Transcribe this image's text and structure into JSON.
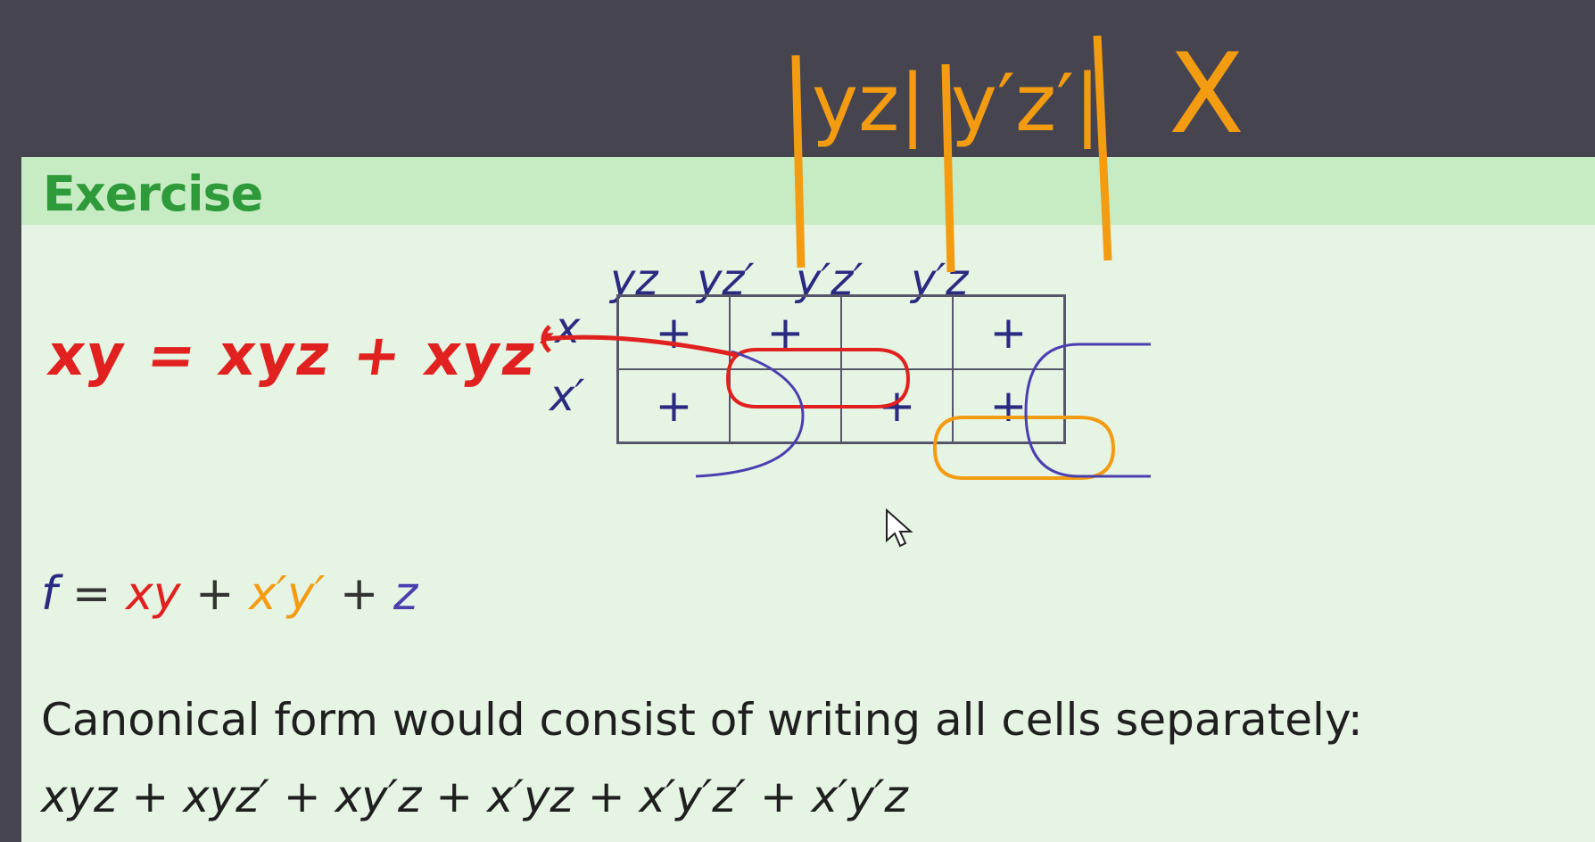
{
  "slide": {
    "title": "Exercise",
    "kmap": {
      "col_headers": [
        "yz",
        "yz′",
        "y′z′",
        "y′z"
      ],
      "row_headers": [
        "x",
        "x′"
      ],
      "cells": [
        [
          "+",
          "+",
          "",
          "+"
        ],
        [
          "+",
          "",
          "+",
          "+"
        ]
      ]
    },
    "function": {
      "lhs": "f",
      "eq": "=",
      "t1": "xy",
      "p1": "+",
      "t2": "x′y′",
      "p2": "+",
      "t3": "z"
    },
    "canonical_text": "Canonical form would consist of writing all cells separately:",
    "canonical_expr": "xyz + xyz′ + xy′z + x′yz + x′y′z′ + x′y′z"
  },
  "annotations": {
    "red_note": "xy = xyz + xyz′",
    "orange_cols": "yz| y′z′|",
    "orange_x": "X"
  },
  "colors": {
    "background": "#45444f",
    "slide": "#e6f4e4",
    "header": "#c7ecc4",
    "title": "#2e9a39",
    "red": "#e0211f",
    "orange": "#f39c12",
    "blue": "#4b3fb0"
  },
  "icons": {
    "cursor": "mouse-pointer-icon"
  }
}
